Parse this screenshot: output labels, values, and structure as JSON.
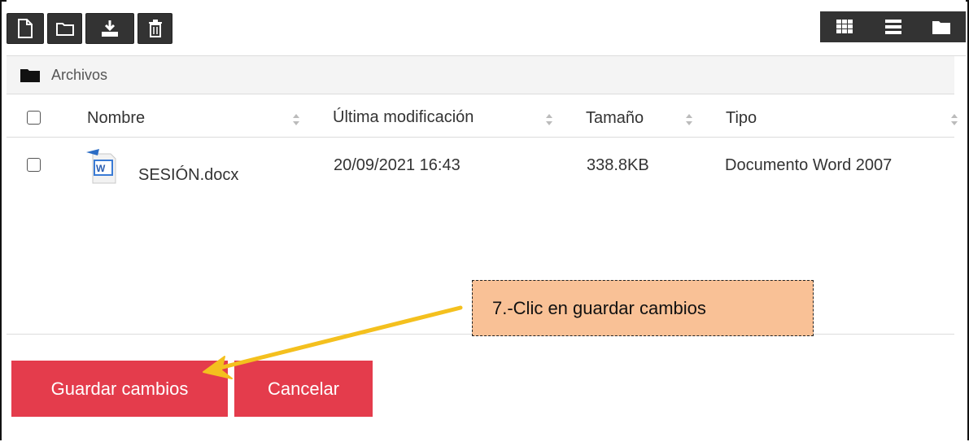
{
  "breadcrumb": {
    "label": "Archivos"
  },
  "table": {
    "headers": {
      "name": "Nombre",
      "modified": "Última modificación",
      "size": "Tamaño",
      "type": "Tipo"
    },
    "rows": [
      {
        "name": "SESIÓN.docx",
        "modified": "20/09/2021 16:43",
        "size": "338.8KB",
        "type": "Documento Word 2007"
      }
    ]
  },
  "actions": {
    "save": "Guardar cambios",
    "cancel": "Cancelar"
  },
  "callout": {
    "text": "7.-Clic en guardar cambios"
  },
  "colors": {
    "primary_red": "#e43c4c",
    "callout_bg": "#f9c196",
    "arrow": "#f4c01e",
    "toolbar_dark": "#333333"
  }
}
